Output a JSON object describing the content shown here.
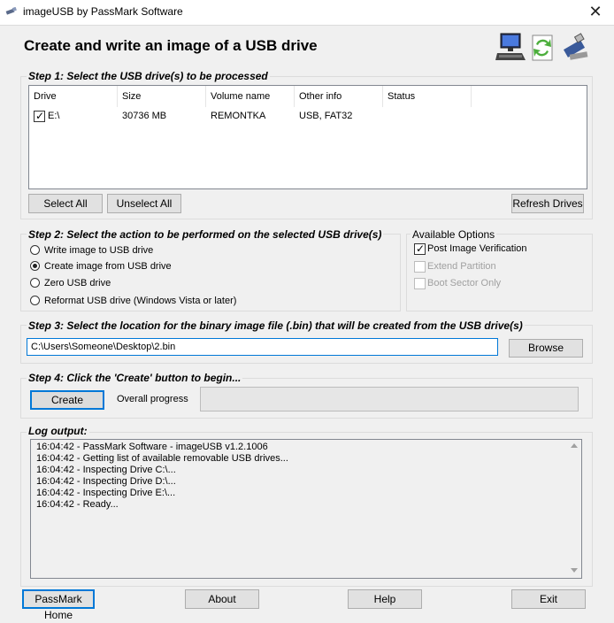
{
  "window": {
    "title": "imageUSB by PassMark Software",
    "close": "✕"
  },
  "heading": "Create and write an image of a USB drive",
  "header_icons": [
    "computer-icon",
    "copy-refresh-icon",
    "usb-drive-icon"
  ],
  "step1": {
    "legend": "Step 1:  Select the USB drive(s) to be processed",
    "columns": [
      "Drive",
      "Size",
      "Volume name",
      "Other info",
      "Status"
    ],
    "rows": [
      {
        "checked": true,
        "drive": "E:\\",
        "size": "30736 MB",
        "volume": "REMONTKA",
        "info": "USB, FAT32",
        "status": ""
      }
    ],
    "select_all": "Select All",
    "unselect_all": "Unselect All",
    "refresh": "Refresh Drives"
  },
  "step2": {
    "legend": "Step 2: Select the action to be performed on the selected USB drive(s)",
    "options": [
      {
        "label": "Write image to USB drive",
        "selected": false
      },
      {
        "label": "Create image from USB drive",
        "selected": true
      },
      {
        "label": "Zero USB drive",
        "selected": false
      },
      {
        "label": "Reformat USB drive (Windows Vista or later)",
        "selected": false
      }
    ]
  },
  "available_options": {
    "legend": "Available Options",
    "items": [
      {
        "label": "Post Image Verification",
        "checked": true,
        "enabled": true
      },
      {
        "label": "Extend Partition",
        "checked": false,
        "enabled": false
      },
      {
        "label": "Boot Sector Only",
        "checked": false,
        "enabled": false
      }
    ]
  },
  "step3": {
    "legend": "Step 3: Select the location for the binary image file (.bin) that will be created from the USB drive(s)",
    "path": "C:\\Users\\Someone\\Desktop\\2.bin",
    "browse": "Browse"
  },
  "step4": {
    "legend": "Step 4: Click the 'Create' button to begin...",
    "create": "Create",
    "progress_label": "Overall progress",
    "progress": 0
  },
  "log": {
    "legend": "Log output:",
    "lines": [
      "16:04:42 - PassMark Software - imageUSB v1.2.1006",
      "16:04:42 - Getting list of available removable USB drives...",
      "16:04:42 - Inspecting Drive C:\\...",
      "16:04:42 - Inspecting Drive D:\\...",
      "16:04:42 - Inspecting Drive E:\\...",
      "16:04:42 - Ready..."
    ]
  },
  "footer": {
    "passmark_home": "PassMark Home",
    "about": "About",
    "help": "Help",
    "exit": "Exit"
  }
}
